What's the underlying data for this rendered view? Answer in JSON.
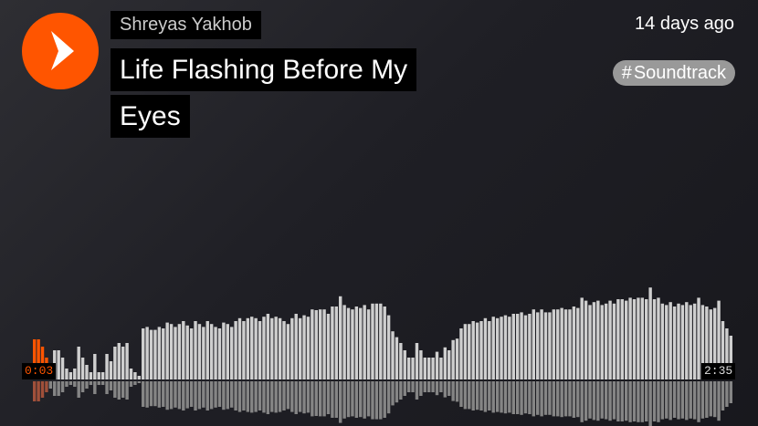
{
  "artist": "Shreyas Yakhob",
  "title": "Life Flashing Before My Eyes",
  "posted": "14 days ago",
  "tag": {
    "hash": "#",
    "label": "Soundtrack"
  },
  "player": {
    "current_time": "0:03",
    "duration": "2:35",
    "progress": 0.019,
    "accent_color": "#ff5500",
    "played_lower_color": "#a0503a",
    "unplayed_color": "#cfcfcf",
    "unplayed_lower_color": "#858585",
    "play_icon": "play-icon"
  },
  "waveform": {
    "peaks": [
      0.55,
      0.55,
      0.45,
      0.3,
      0.2,
      0.4,
      0.4,
      0.3,
      0.15,
      0.1,
      0.15,
      0.45,
      0.3,
      0.2,
      0.1,
      0.35,
      0.1,
      0.1,
      0.35,
      0.25,
      0.45,
      0.5,
      0.45,
      0.5,
      0.15,
      0.1,
      0.05,
      0.7,
      0.72,
      0.68,
      0.68,
      0.72,
      0.7,
      0.78,
      0.76,
      0.72,
      0.76,
      0.8,
      0.74,
      0.7,
      0.8,
      0.76,
      0.72,
      0.8,
      0.76,
      0.72,
      0.7,
      0.78,
      0.76,
      0.72,
      0.8,
      0.84,
      0.8,
      0.84,
      0.86,
      0.84,
      0.8,
      0.86,
      0.9,
      0.84,
      0.86,
      0.84,
      0.8,
      0.76,
      0.84,
      0.9,
      0.84,
      0.88,
      0.86,
      0.96,
      0.95,
      0.96,
      0.96,
      0.9,
      1.0,
      1.0,
      1.14,
      1.02,
      0.98,
      0.96,
      1.0,
      0.98,
      1.02,
      0.96,
      1.04,
      1.04,
      1.04,
      1.0,
      0.88,
      0.66,
      0.58,
      0.5,
      0.4,
      0.3,
      0.3,
      0.5,
      0.4,
      0.3,
      0.3,
      0.3,
      0.38,
      0.3,
      0.44,
      0.4,
      0.54,
      0.56,
      0.7,
      0.76,
      0.76,
      0.8,
      0.78,
      0.8,
      0.84,
      0.8,
      0.86,
      0.84,
      0.86,
      0.88,
      0.86,
      0.9,
      0.9,
      0.92,
      0.88,
      0.9,
      0.96,
      0.92,
      0.96,
      0.92,
      0.92,
      0.96,
      0.96,
      0.98,
      0.96,
      0.96,
      1.0,
      0.98,
      1.12,
      1.08,
      1.02,
      1.06,
      1.08,
      1.02,
      1.04,
      1.08,
      1.04,
      1.1,
      1.1,
      1.08,
      1.12,
      1.1,
      1.12,
      1.12,
      1.1,
      1.26,
      1.1,
      1.12,
      1.04,
      1.02,
      1.06,
      1.0,
      1.04,
      1.02,
      1.06,
      1.02,
      1.04,
      1.12,
      1.02,
      1.0,
      0.96,
      0.98,
      1.08,
      0.8,
      0.7,
      0.6
    ]
  }
}
